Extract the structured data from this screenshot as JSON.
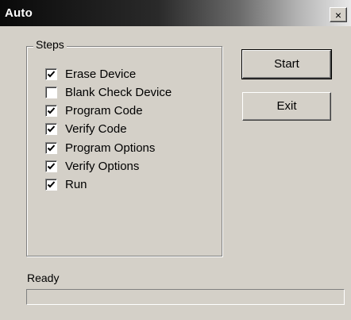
{
  "window": {
    "title": "Auto",
    "close_glyph": "×"
  },
  "steps": {
    "group_label": "Steps",
    "items": [
      {
        "label": "Erase Device",
        "checked": true
      },
      {
        "label": "Blank Check Device",
        "checked": false
      },
      {
        "label": "Program Code",
        "checked": true
      },
      {
        "label": "Verify Code",
        "checked": true
      },
      {
        "label": "Program Options",
        "checked": true
      },
      {
        "label": "Verify Options",
        "checked": true
      },
      {
        "label": "Run",
        "checked": true
      }
    ]
  },
  "buttons": {
    "start_label": "Start",
    "exit_label": "Exit"
  },
  "status": {
    "text": "Ready",
    "progress": 0
  }
}
